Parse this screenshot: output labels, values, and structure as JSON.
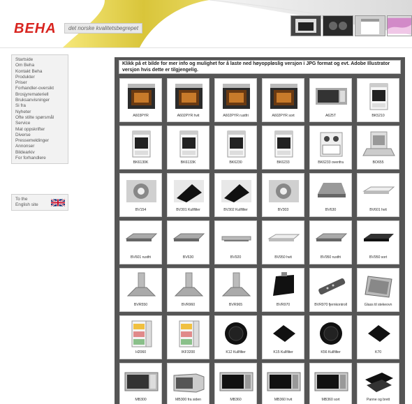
{
  "header": {
    "logo": "BEHA",
    "tagline": "det norske kvalitetsbegrepet",
    "thumbnail_icons": [
      "oven-thumb-icon",
      "stove-thumb-icon",
      "dishwasher-thumb-icon",
      "pink-thumb-icon"
    ]
  },
  "sidebar": {
    "items": [
      "Startside",
      "Om Beha",
      "Kontakt Beha",
      "Produkter",
      "Priser",
      "Forhandler-oversikt",
      "Brosjyremateriell",
      "Bruksanvisninger",
      "Si fra",
      "Nyheter",
      "Ofte stilte spørsmål",
      "Service",
      "Mat oppskrifter",
      "Diverse",
      "Pressemeldinger",
      "Annonser",
      "Bildearkiv",
      "For forhandlere"
    ],
    "english_label": "To the English site",
    "flag_icon": "uk-flag-icon"
  },
  "content": {
    "info": "Klikk på et bilde for mer info og mulighet for å laste ned høyoppløslig versjon i JPG format og evt. Adobe Illustrator versjon hvis dette er tilgjengelig.",
    "products": [
      {
        "label": "A603PYR",
        "icon": "oven-black-icon"
      },
      {
        "label": "A602PYR hvit",
        "icon": "oven-black-icon"
      },
      {
        "label": "A602PYR rustfri",
        "icon": "oven-black-icon"
      },
      {
        "label": "A602PYR sort",
        "icon": "oven-black-icon"
      },
      {
        "label": "A625T",
        "icon": "built-in-microwave-icon"
      },
      {
        "label": "BK5210",
        "icon": "stove-white-icon"
      },
      {
        "label": "BK6130K",
        "icon": "stove-white-icon"
      },
      {
        "label": "BK6133K",
        "icon": "stove-white-icon"
      },
      {
        "label": "BK6230",
        "icon": "stove-white-icon"
      },
      {
        "label": "BK6233",
        "icon": "stove-white-icon"
      },
      {
        "label": "BK6233 ovenfra",
        "icon": "stove-top-view-icon"
      },
      {
        "label": "BO655",
        "icon": "dishwasher-open-icon"
      },
      {
        "label": "BV154",
        "icon": "vent-fan-icon"
      },
      {
        "label": "BV301 Kullfilter",
        "icon": "hood-filter-icon"
      },
      {
        "label": "BV302 Kullfilter",
        "icon": "hood-filter-icon"
      },
      {
        "label": "BV303",
        "icon": "vent-fan-icon"
      },
      {
        "label": "BV630",
        "icon": "hood-steel-icon"
      },
      {
        "label": "BV601 hvit",
        "icon": "hood-flat-white-icon"
      },
      {
        "label": "BV601 rustfri",
        "icon": "hood-flat-steel-icon"
      },
      {
        "label": "BV630",
        "icon": "hood-flat-steel-icon"
      },
      {
        "label": "BV920",
        "icon": "hood-slim-icon"
      },
      {
        "label": "BV950 hvit",
        "icon": "hood-flat-white-icon"
      },
      {
        "label": "BV950 rustfri",
        "icon": "hood-flat-steel-icon"
      },
      {
        "label": "BV950 sort",
        "icon": "hood-flat-black-icon"
      },
      {
        "label": "BVR550",
        "icon": "chimney-hood-icon"
      },
      {
        "label": "BVR960",
        "icon": "chimney-hood-icon"
      },
      {
        "label": "BVR965",
        "icon": "chimney-hood-icon"
      },
      {
        "label": "BVR970",
        "icon": "angled-black-hood-icon"
      },
      {
        "label": "BVR970 fjernkontroll",
        "icon": "remote-control-icon"
      },
      {
        "label": "Glass til stekeovn",
        "icon": "glass-panel-icon"
      },
      {
        "label": "H2060",
        "icon": "fridge-open-icon"
      },
      {
        "label": "IKF3200",
        "icon": "fridge-open-icon"
      },
      {
        "label": "K12 Kullfilter",
        "icon": "round-filter-icon"
      },
      {
        "label": "K15 Kullfilter",
        "icon": "square-filter-icon"
      },
      {
        "label": "K56 Kullfilter",
        "icon": "round-filter-icon"
      },
      {
        "label": "K70",
        "icon": "square-filter-icon"
      },
      {
        "label": "MB300",
        "icon": "microwave-icon"
      },
      {
        "label": "MB300 fra siden",
        "icon": "microwave-side-icon"
      },
      {
        "label": "MB360",
        "icon": "microwave-dark-icon"
      },
      {
        "label": "MB360 hvit",
        "icon": "microwave-dark-icon"
      },
      {
        "label": "MB360 sort",
        "icon": "microwave-dark-icon"
      },
      {
        "label": "Panne og brett",
        "icon": "pan-tray-icon"
      }
    ]
  }
}
